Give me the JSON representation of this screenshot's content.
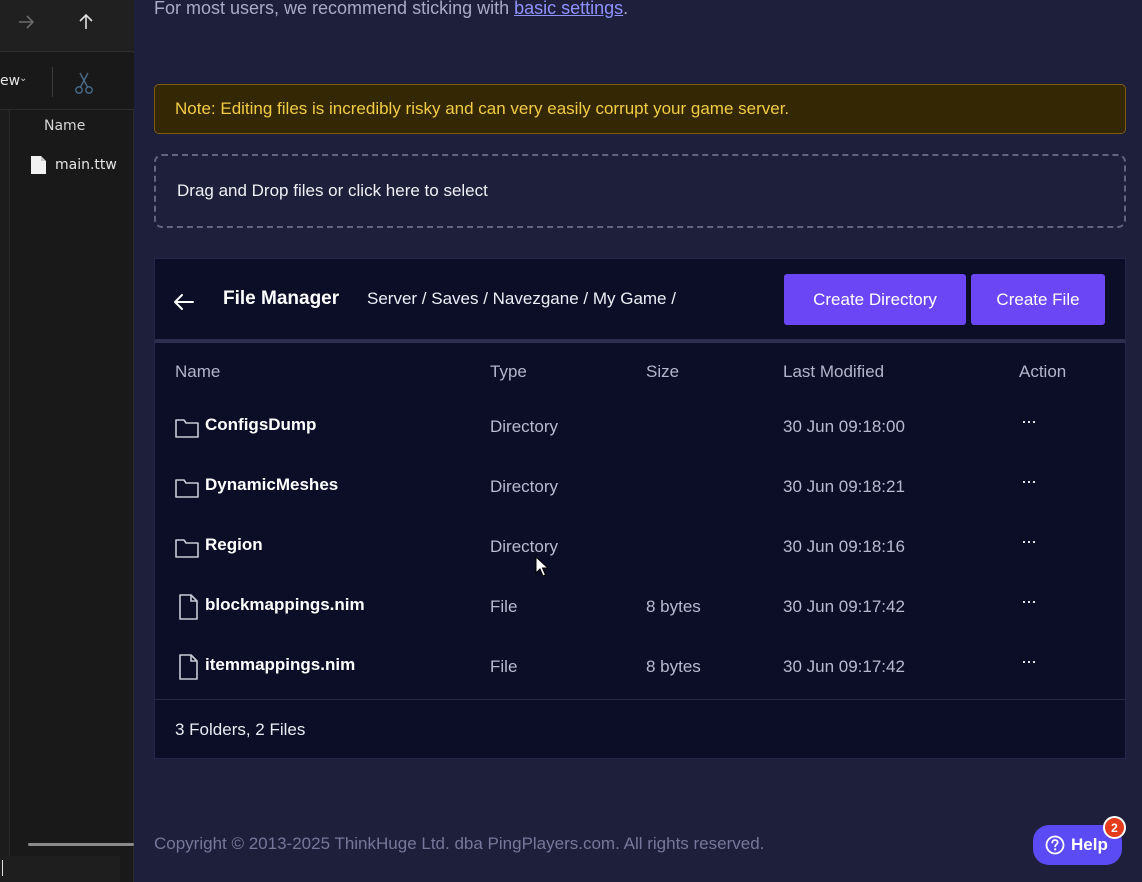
{
  "explorer": {
    "view_label": "ew",
    "column_header": "Name",
    "file_name": "main.ttw"
  },
  "main": {
    "recommend_text": "For most users, we recommend sticking with ",
    "recommend_link": "basic settings",
    "recommend_suffix": ".",
    "note_text": "Note: Editing files is incredibly risky and can very easily corrupt your game server.",
    "dropzone_text": "Drag and Drop files or click here to select"
  },
  "file_manager": {
    "title": "File Manager",
    "breadcrumb": "Server / Saves / Navezgane / My Game /",
    "create_directory_label": "Create Directory",
    "create_file_label": "Create File",
    "columns": {
      "name": "Name",
      "type": "Type",
      "size": "Size",
      "modified": "Last Modified",
      "action": "Action"
    },
    "rows": [
      {
        "name": "ConfigsDump",
        "type": "Directory",
        "size": "",
        "modified": "30 Jun 09:18:00",
        "action": "···",
        "icon": "folder-icon"
      },
      {
        "name": "DynamicMeshes",
        "type": "Directory",
        "size": "",
        "modified": "30 Jun 09:18:21",
        "action": "···",
        "icon": "folder-icon"
      },
      {
        "name": "Region",
        "type": "Directory",
        "size": "",
        "modified": "30 Jun 09:18:16",
        "action": "···",
        "icon": "folder-icon"
      },
      {
        "name": "blockmappings.nim",
        "type": "File",
        "size": "8 bytes",
        "modified": "30 Jun 09:17:42",
        "action": "···",
        "icon": "file-icon"
      },
      {
        "name": "itemmappings.nim",
        "type": "File",
        "size": "8 bytes",
        "modified": "30 Jun 09:17:42",
        "action": "···",
        "icon": "file-icon"
      }
    ],
    "footer": "3 Folders, 2 Files"
  },
  "copyright": "Copyright © 2013-2025 ThinkHuge Ltd. dba PingPlayers.com. All rights reserved.",
  "help": {
    "label": "Help",
    "badge_count": "2"
  },
  "colors": {
    "accent": "#6b46f5",
    "note_bg": "#342703",
    "note_text": "#f2cc45",
    "page_bg": "#1e1f3a",
    "panel_bg": "#0c0e28",
    "badge": "#e33b1b"
  }
}
